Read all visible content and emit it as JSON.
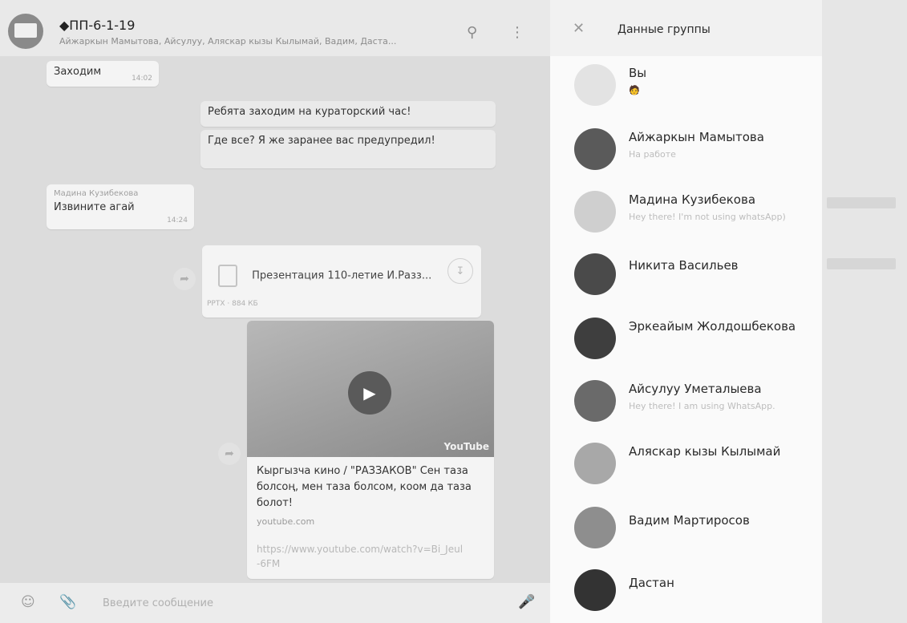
{
  "header": {
    "title": "◆ПП-6-1-19",
    "members": "Айжаркын Мамытова, Айсулуу, Аляскар кызы Кылымай, Вадим, Даста..."
  },
  "messages": [
    {
      "text": "Заходим",
      "time": "14:02"
    },
    {
      "text": "Ребята заходим на кураторский час!",
      "time": ""
    },
    {
      "text": "Где все? Я же заранее вас предупредил!",
      "time": ""
    },
    {
      "sender": "Мадина Кузибекова",
      "text": "Извините агай",
      "time": "14:24"
    }
  ],
  "document": {
    "name": "Презентация 110-летие И.Разз...",
    "meta": "PPTX · 884 КБ"
  },
  "link_preview": {
    "title": "Кыргызча кино / \"РАЗЗАКОВ\" Сен таза болсоң, мен таза болсом, коом да таза болот!",
    "site": "youtube.com",
    "url": "https://www.youtube.com/watch?v=Bi_Jeul-6FM",
    "yt_label": "YouTube"
  },
  "composer": {
    "placeholder": "Введите сообщение"
  },
  "panel": {
    "title": "Данные группы",
    "participants": [
      {
        "name": "Вы",
        "status": "🧑"
      },
      {
        "name": "Айжаркын Мамытова",
        "status": "На работе"
      },
      {
        "name": "Мадина Кузибекова",
        "status": "Hey there! I'm not using whatsApp)"
      },
      {
        "name": "Никита Васильев",
        "status": ""
      },
      {
        "name": "Эркеайым Жолдошбекова",
        "status": ""
      },
      {
        "name": "Айсулуу Уметалыева",
        "status": "Hey there! I am using WhatsApp."
      },
      {
        "name": "Аляскар кызы Кылымай",
        "status": ""
      },
      {
        "name": "Вадим Мартиросов",
        "status": ""
      },
      {
        "name": "Дастан",
        "status": ""
      }
    ]
  },
  "colors": {
    "panel_bg": "#fafafa",
    "chat_bg": "#dcdcdc",
    "accent_text": "#2a2a2a",
    "muted_text": "#bdbdbd"
  },
  "icons": {
    "search": "search-icon",
    "menu": "menu-dots-icon",
    "close": "close-icon",
    "emoji": "emoji-icon",
    "attach": "attach-icon",
    "mic": "mic-icon",
    "forward": "forward-icon",
    "play": "play-icon",
    "download": "download-icon"
  }
}
